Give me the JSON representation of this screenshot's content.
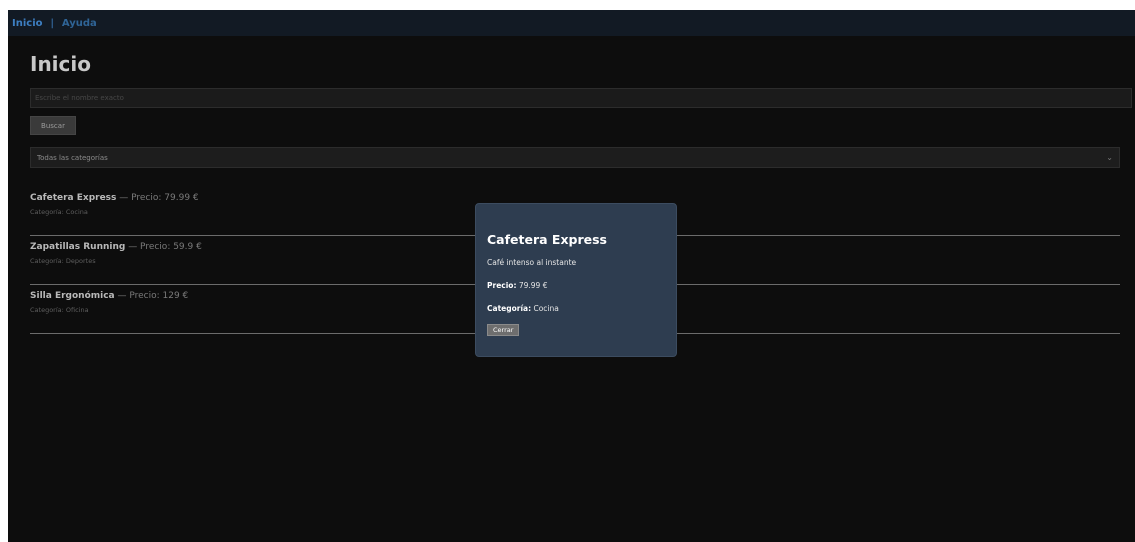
{
  "nav": {
    "home": "Inicio",
    "separator": "|",
    "help": "Ayuda"
  },
  "page": {
    "title": "Inicio"
  },
  "search": {
    "placeholder": "Escribe el nombre exacto",
    "button_label": "Buscar"
  },
  "filter": {
    "selected": "Todas las categorías"
  },
  "products": [
    {
      "name": "Cafetera Express",
      "price_text": " — Precio: 79.99 €",
      "category_text": "Categoría: Cocina"
    },
    {
      "name": "Zapatillas Running",
      "price_text": " — Precio: 59.9 €",
      "category_text": "Categoría: Deportes"
    },
    {
      "name": "Silla Ergonómica",
      "price_text": " — Precio: 129 €",
      "category_text": "Categoría: Oficina"
    }
  ],
  "modal": {
    "title": "Cafetera Express",
    "description": "Café intenso al instante",
    "price_label": "Precio:",
    "price_value": " 79.99 €",
    "category_label": "Categoría:",
    "category_value": " Cocina",
    "close_label": "Cerrar"
  },
  "colors": {
    "background": "#0d0d0d",
    "nav_background": "#121a24",
    "nav_link": "#3d7fc2",
    "modal_background": "#2e3d50"
  },
  "icons": {
    "select_chevron": "chevron-down-icon"
  }
}
